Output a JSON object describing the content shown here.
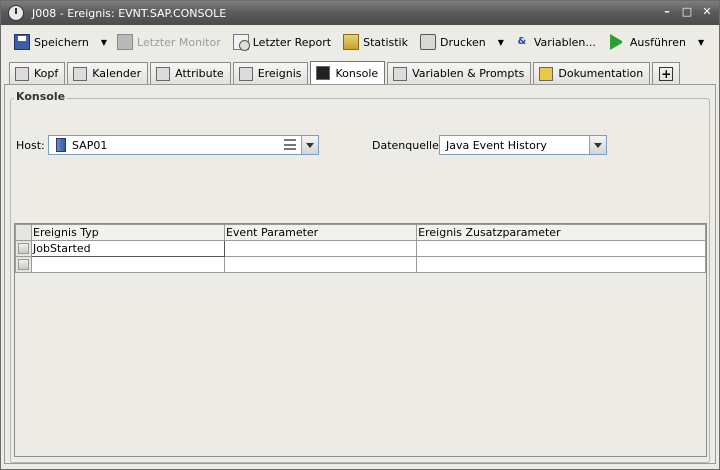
{
  "window": {
    "title": "J008 - Ereignis: EVNT.SAP.CONSOLE",
    "controls": [
      "minimize",
      "maximize",
      "close"
    ]
  },
  "toolbar": {
    "save_label": "Speichern",
    "last_monitor_label": "Letzter Monitor",
    "last_report_label": "Letzter Report",
    "statistics_label": "Statistik",
    "print_label": "Drucken",
    "variables_label": "Variablen...",
    "execute_label": "Ausführen"
  },
  "tabs": [
    {
      "label": "Kopf",
      "icon": "header-icon"
    },
    {
      "label": "Kalender",
      "icon": "calendar-icon"
    },
    {
      "label": "Attribute",
      "icon": "attributes-icon"
    },
    {
      "label": "Ereignis",
      "icon": "event-icon"
    },
    {
      "label": "Konsole",
      "icon": "console-icon",
      "active": true
    },
    {
      "label": "Variablen & Prompts",
      "icon": "variables-icon"
    },
    {
      "label": "Dokumentation",
      "icon": "documentation-icon"
    }
  ],
  "tab_add_label": "+",
  "console": {
    "group_title": "Konsole",
    "host_label": "Host:",
    "host_value": "SAP01",
    "datasource_label": "Datenquelle:",
    "datasource_value": "Java Event History"
  },
  "table": {
    "columns": [
      "Ereignis Typ",
      "Event Parameter",
      "Ereignis Zusatzparameter"
    ],
    "rows": [
      [
        "JobStarted",
        "",
        ""
      ],
      [
        "",
        "",
        ""
      ]
    ]
  }
}
